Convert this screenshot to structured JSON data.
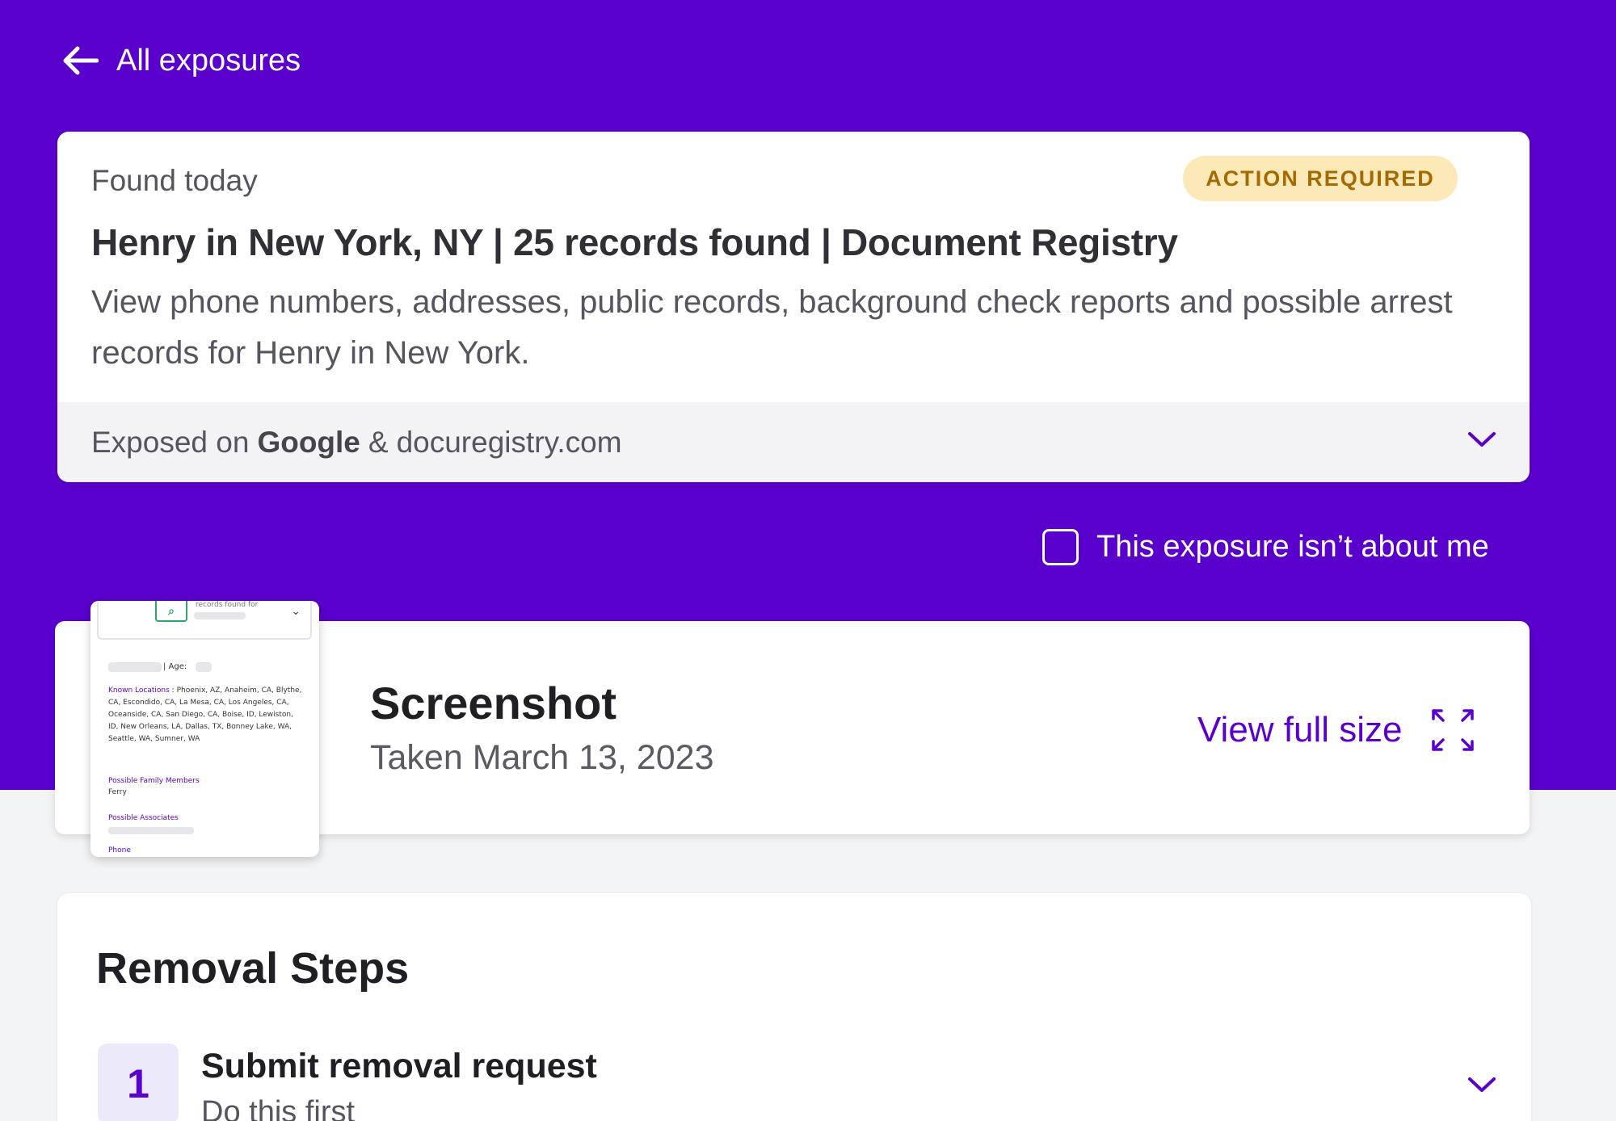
{
  "nav": {
    "back_label": "All exposures"
  },
  "exposure": {
    "found_label": "Found today",
    "badge": "ACTION REQUIRED",
    "title": "Henry in New York, NY | 25 records found | Document Registry",
    "description": "View phone numbers, addresses, public records, background check reports and possible arrest records for Henry in New York.",
    "exposed_prefix": "Exposed on",
    "exposed_source": "Google",
    "exposed_amp": "&",
    "exposed_site": "docuregistry.com"
  },
  "not_me": {
    "label": "This exposure isn’t about me",
    "checked": false
  },
  "screenshot": {
    "title": "Screenshot",
    "taken": "Taken March 13, 2023",
    "view_full": "View full size",
    "thumb": {
      "header_text": "records found for",
      "age_label": "| Age:",
      "known_locations_label": "Known Locations",
      "known_locations": ": Phoenix, AZ, Anaheim, CA, Blythe, CA, Escondido, CA, La Mesa, CA, Los Angeles, CA, Oceanside, CA, San Diego, CA, Boise, ID, Lewiston, ID, New Orleans, LA, Dallas, TX, Bonney Lake, WA, Seattle, WA, Sumner, WA",
      "family_label": "Possible Family Members",
      "family_extra": "Ferry",
      "associates_label": "Possible Associates",
      "phone_label": "Phone"
    }
  },
  "removal": {
    "title": "Removal Steps",
    "steps": [
      {
        "number": "1",
        "title": "Submit removal request",
        "subtitle": "Do this first"
      }
    ]
  },
  "colors": {
    "brand": "#5a00cd",
    "badge_bg": "#fde9b8",
    "badge_text": "#a26a00"
  },
  "icons": [
    "arrow-left-icon",
    "chevron-down-icon",
    "expand-icon",
    "search-icon"
  ]
}
